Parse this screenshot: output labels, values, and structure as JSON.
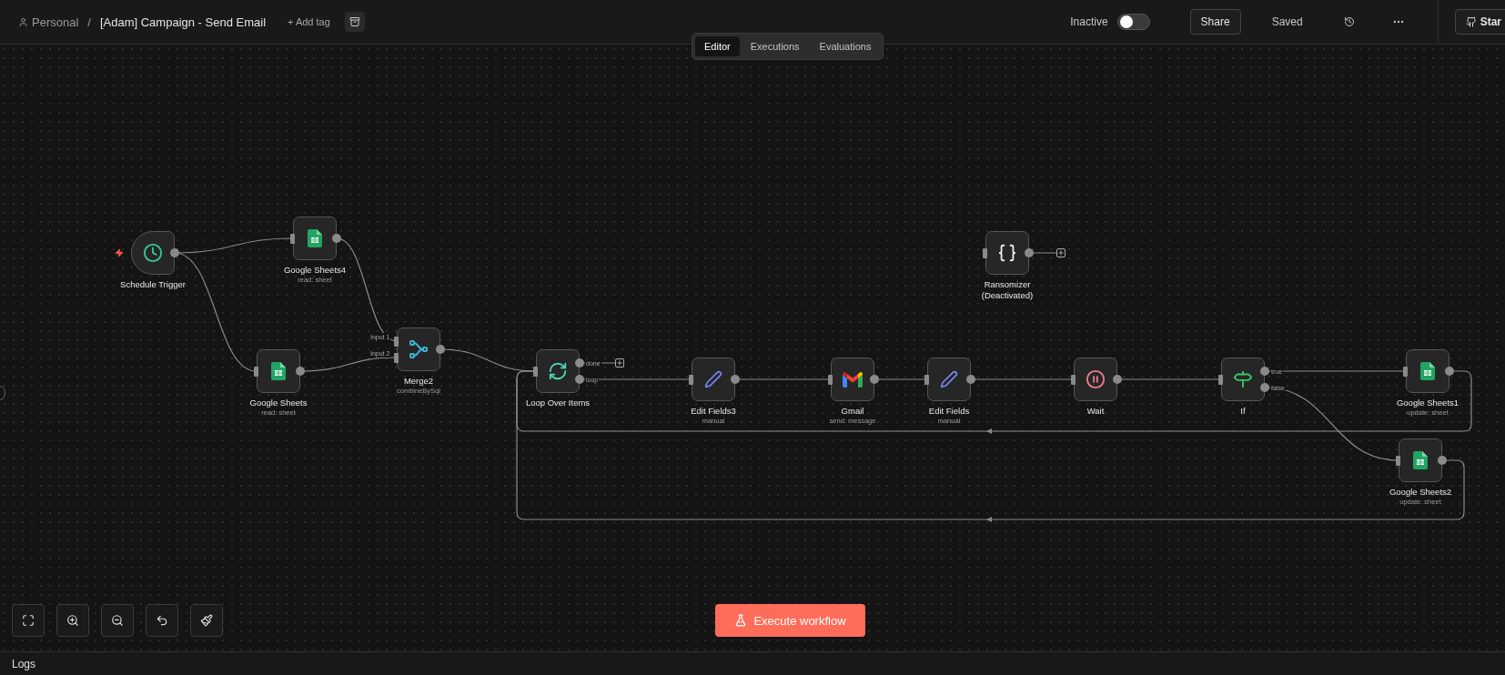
{
  "breadcrumb": {
    "owner": "Personal",
    "separator": "/",
    "title": "[Adam] Campaign - Send Email"
  },
  "add_tag": "+ Add tag",
  "activation": {
    "label": "Inactive",
    "on": false
  },
  "share": "Share",
  "save_state": "Saved",
  "github": "Star",
  "tabs": [
    {
      "label": "Editor",
      "selected": true
    },
    {
      "label": "Executions",
      "selected": false
    },
    {
      "label": "Evaluations",
      "selected": false
    }
  ],
  "nodes": [
    {
      "name": "Schedule Trigger",
      "kind": "trigger"
    },
    {
      "name": "Google Sheets4",
      "subtitle": "read: sheet",
      "kind": "sheets"
    },
    {
      "name": "Google Sheets",
      "subtitle": "read: sheet",
      "kind": "sheets"
    },
    {
      "name": "Merge2",
      "subtitle": "combineBySql",
      "kind": "merge",
      "inputs": [
        "Input 1",
        "Input 2"
      ]
    },
    {
      "name": "Loop Over Items",
      "kind": "loop",
      "outputs": [
        "done",
        "loop"
      ]
    },
    {
      "name": "Edit Fields3",
      "subtitle": "manual",
      "kind": "edit"
    },
    {
      "name": "Gmail",
      "subtitle": "send: message",
      "kind": "gmail"
    },
    {
      "name": "Edit Fields",
      "subtitle": "manual",
      "kind": "edit"
    },
    {
      "name": "Wait",
      "kind": "wait"
    },
    {
      "name": "If",
      "kind": "if",
      "outputs": [
        "true",
        "false"
      ]
    },
    {
      "name": "Google Sheets1",
      "subtitle": "update: sheet",
      "kind": "sheets"
    },
    {
      "name": "Google Sheets2",
      "subtitle": "update: sheet",
      "kind": "sheets"
    },
    {
      "name": "Ransomizer",
      "status": "(Deactivated)",
      "kind": "code"
    }
  ],
  "execute_button": "Execute workflow",
  "logs": "Logs"
}
